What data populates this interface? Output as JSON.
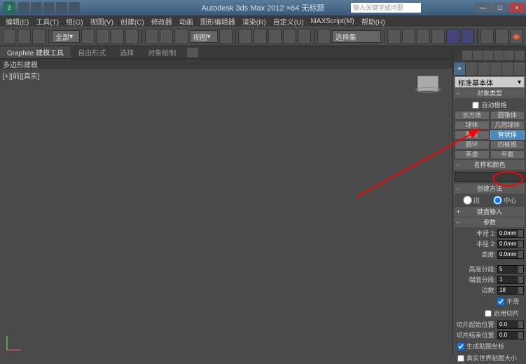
{
  "titlebar": {
    "app_logo": "3",
    "title": "Autodesk 3ds Max 2012 ×64   无标题",
    "search_placeholder": "输入关键字或问题"
  },
  "menubar": {
    "items": [
      "编辑(E)",
      "工具(T)",
      "组(G)",
      "视图(V)",
      "创建(C)",
      "修改器",
      "动画",
      "图形编辑器",
      "渲染(R)",
      "自定义(U)",
      "MAXScript(M)",
      "帮助(H)"
    ]
  },
  "toolbar": {
    "selection_filter": "全部",
    "view_mode": "视图",
    "named_set": "选择集"
  },
  "ribbon": {
    "tabs": [
      "Graphite 建模工具",
      "自由形式",
      "选择",
      "对象绘制"
    ]
  },
  "subbar": {
    "label": "多边形建模"
  },
  "viewport": {
    "label": "[+][前][真实]"
  },
  "command_panel": {
    "category": "标准基本体",
    "rollouts": {
      "object_type": {
        "title": "对象类型",
        "auto_grid": "自动栅格",
        "buttons": [
          [
            "长方体",
            "圆锥体"
          ],
          [
            "球体",
            "几何球体"
          ],
          [
            "圆柱",
            "管状体"
          ],
          [
            "圆环",
            "四棱锥"
          ],
          [
            "茶壶",
            "平面"
          ]
        ]
      },
      "name_color": {
        "title": "名称和颜色"
      },
      "creation_method": {
        "title": "创建方法",
        "opt1": "边",
        "opt2": "中心"
      },
      "keyboard": {
        "title": "键盘输入"
      },
      "parameters": {
        "title": "参数",
        "radius1_label": "半径 1:",
        "radius1_val": "0.0mm",
        "radius2_label": "半径 2:",
        "radius2_val": "0.0mm",
        "height_label": "高度:",
        "height_val": "0.0mm",
        "height_segs_label": "高度分段:",
        "height_segs_val": "5",
        "cap_segs_label": "端面分段:",
        "cap_segs_val": "1",
        "sides_label": "边数:",
        "sides_val": "18",
        "smooth": "平滑",
        "slice_on": "启用切片",
        "slice_from_label": "切片起始位置:",
        "slice_from_val": "0.0",
        "slice_to_label": "切片结束位置:",
        "slice_to_val": "0.0",
        "gen_uv": "生成贴图坐标",
        "real_world": "真实世界贴图大小"
      }
    }
  }
}
